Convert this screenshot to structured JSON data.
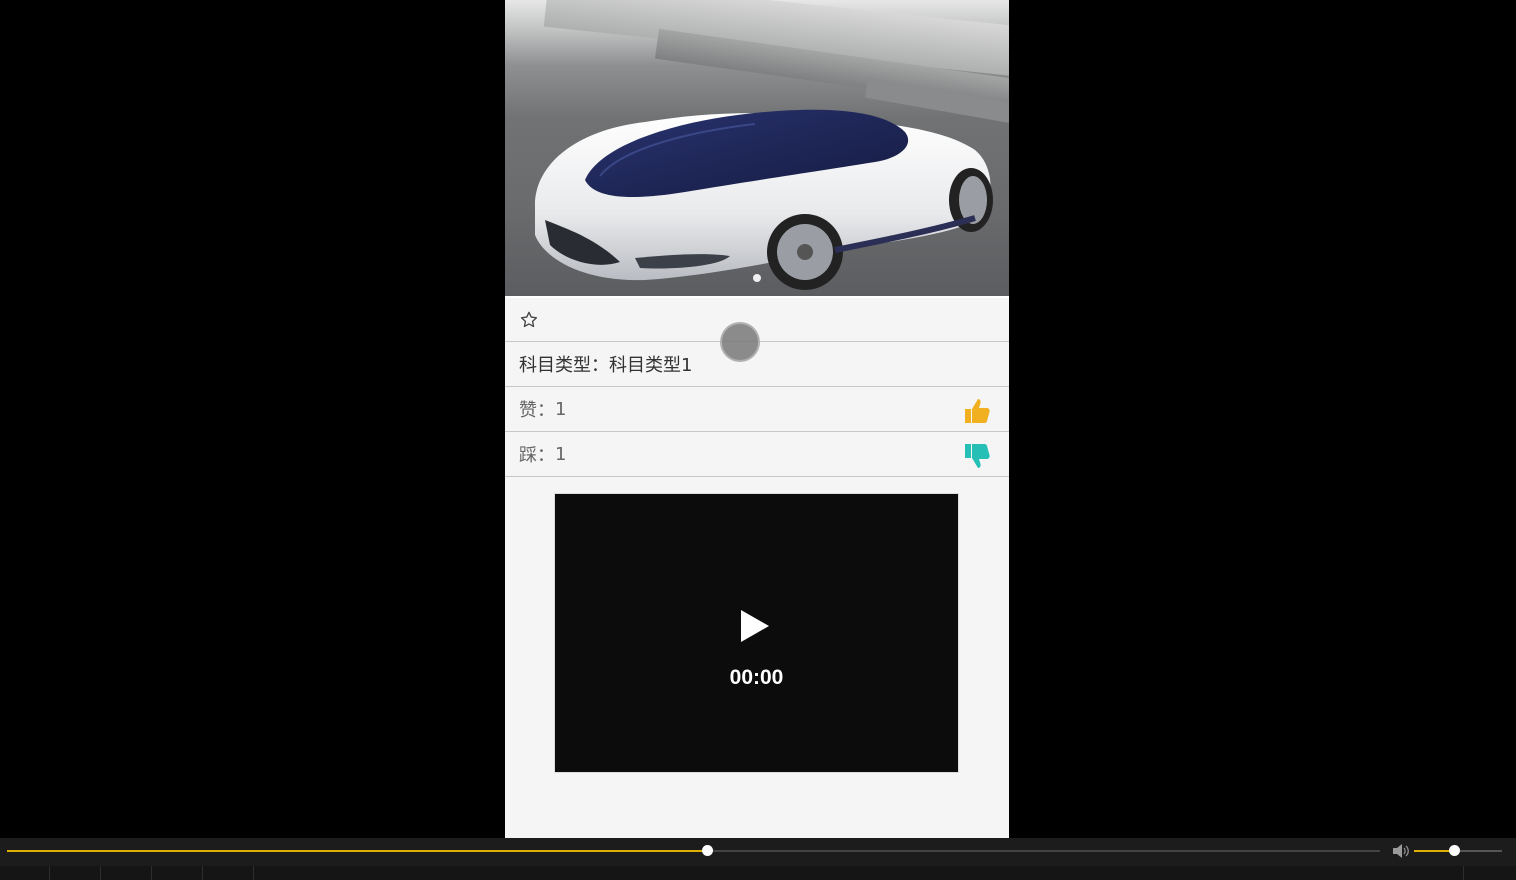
{
  "detail": {
    "subject_type_label": "科目类型：",
    "subject_type_value": "科目类型1",
    "likes_label": "赞：",
    "likes_count": "1",
    "dislikes_label": "踩：",
    "dislikes_count": "1"
  },
  "video": {
    "current_time": "00:00"
  },
  "player": {
    "progress_fraction": 0.51,
    "volume_fraction": 0.45
  },
  "colors": {
    "accent": "#e0b000",
    "thumb_up": "#f0b020",
    "thumb_down": "#26bfb5"
  },
  "icons": {
    "favorite": "star-outline-icon",
    "like": "thumbs-up-icon",
    "dislike": "thumbs-down-icon",
    "play": "play-icon",
    "volume": "volume-icon"
  }
}
